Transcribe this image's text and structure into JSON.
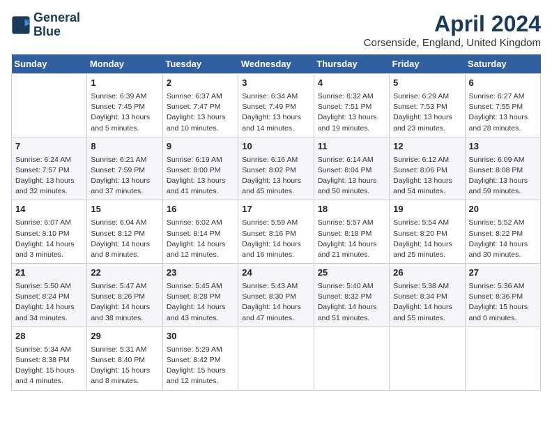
{
  "header": {
    "logo_line1": "General",
    "logo_line2": "Blue",
    "month_title": "April 2024",
    "location": "Corsenside, England, United Kingdom"
  },
  "days_of_week": [
    "Sunday",
    "Monday",
    "Tuesday",
    "Wednesday",
    "Thursday",
    "Friday",
    "Saturday"
  ],
  "weeks": [
    [
      {
        "day": "",
        "info": ""
      },
      {
        "day": "1",
        "info": "Sunrise: 6:39 AM\nSunset: 7:45 PM\nDaylight: 13 hours\nand 5 minutes."
      },
      {
        "day": "2",
        "info": "Sunrise: 6:37 AM\nSunset: 7:47 PM\nDaylight: 13 hours\nand 10 minutes."
      },
      {
        "day": "3",
        "info": "Sunrise: 6:34 AM\nSunset: 7:49 PM\nDaylight: 13 hours\nand 14 minutes."
      },
      {
        "day": "4",
        "info": "Sunrise: 6:32 AM\nSunset: 7:51 PM\nDaylight: 13 hours\nand 19 minutes."
      },
      {
        "day": "5",
        "info": "Sunrise: 6:29 AM\nSunset: 7:53 PM\nDaylight: 13 hours\nand 23 minutes."
      },
      {
        "day": "6",
        "info": "Sunrise: 6:27 AM\nSunset: 7:55 PM\nDaylight: 13 hours\nand 28 minutes."
      }
    ],
    [
      {
        "day": "7",
        "info": "Sunrise: 6:24 AM\nSunset: 7:57 PM\nDaylight: 13 hours\nand 32 minutes."
      },
      {
        "day": "8",
        "info": "Sunrise: 6:21 AM\nSunset: 7:59 PM\nDaylight: 13 hours\nand 37 minutes."
      },
      {
        "day": "9",
        "info": "Sunrise: 6:19 AM\nSunset: 8:00 PM\nDaylight: 13 hours\nand 41 minutes."
      },
      {
        "day": "10",
        "info": "Sunrise: 6:16 AM\nSunset: 8:02 PM\nDaylight: 13 hours\nand 45 minutes."
      },
      {
        "day": "11",
        "info": "Sunrise: 6:14 AM\nSunset: 8:04 PM\nDaylight: 13 hours\nand 50 minutes."
      },
      {
        "day": "12",
        "info": "Sunrise: 6:12 AM\nSunset: 8:06 PM\nDaylight: 13 hours\nand 54 minutes."
      },
      {
        "day": "13",
        "info": "Sunrise: 6:09 AM\nSunset: 8:08 PM\nDaylight: 13 hours\nand 59 minutes."
      }
    ],
    [
      {
        "day": "14",
        "info": "Sunrise: 6:07 AM\nSunset: 8:10 PM\nDaylight: 14 hours\nand 3 minutes."
      },
      {
        "day": "15",
        "info": "Sunrise: 6:04 AM\nSunset: 8:12 PM\nDaylight: 14 hours\nand 8 minutes."
      },
      {
        "day": "16",
        "info": "Sunrise: 6:02 AM\nSunset: 8:14 PM\nDaylight: 14 hours\nand 12 minutes."
      },
      {
        "day": "17",
        "info": "Sunrise: 5:59 AM\nSunset: 8:16 PM\nDaylight: 14 hours\nand 16 minutes."
      },
      {
        "day": "18",
        "info": "Sunrise: 5:57 AM\nSunset: 8:18 PM\nDaylight: 14 hours\nand 21 minutes."
      },
      {
        "day": "19",
        "info": "Sunrise: 5:54 AM\nSunset: 8:20 PM\nDaylight: 14 hours\nand 25 minutes."
      },
      {
        "day": "20",
        "info": "Sunrise: 5:52 AM\nSunset: 8:22 PM\nDaylight: 14 hours\nand 30 minutes."
      }
    ],
    [
      {
        "day": "21",
        "info": "Sunrise: 5:50 AM\nSunset: 8:24 PM\nDaylight: 14 hours\nand 34 minutes."
      },
      {
        "day": "22",
        "info": "Sunrise: 5:47 AM\nSunset: 8:26 PM\nDaylight: 14 hours\nand 38 minutes."
      },
      {
        "day": "23",
        "info": "Sunrise: 5:45 AM\nSunset: 8:28 PM\nDaylight: 14 hours\nand 43 minutes."
      },
      {
        "day": "24",
        "info": "Sunrise: 5:43 AM\nSunset: 8:30 PM\nDaylight: 14 hours\nand 47 minutes."
      },
      {
        "day": "25",
        "info": "Sunrise: 5:40 AM\nSunset: 8:32 PM\nDaylight: 14 hours\nand 51 minutes."
      },
      {
        "day": "26",
        "info": "Sunrise: 5:38 AM\nSunset: 8:34 PM\nDaylight: 14 hours\nand 55 minutes."
      },
      {
        "day": "27",
        "info": "Sunrise: 5:36 AM\nSunset: 8:36 PM\nDaylight: 15 hours\nand 0 minutes."
      }
    ],
    [
      {
        "day": "28",
        "info": "Sunrise: 5:34 AM\nSunset: 8:38 PM\nDaylight: 15 hours\nand 4 minutes."
      },
      {
        "day": "29",
        "info": "Sunrise: 5:31 AM\nSunset: 8:40 PM\nDaylight: 15 hours\nand 8 minutes."
      },
      {
        "day": "30",
        "info": "Sunrise: 5:29 AM\nSunset: 8:42 PM\nDaylight: 15 hours\nand 12 minutes."
      },
      {
        "day": "",
        "info": ""
      },
      {
        "day": "",
        "info": ""
      },
      {
        "day": "",
        "info": ""
      },
      {
        "day": "",
        "info": ""
      }
    ]
  ]
}
